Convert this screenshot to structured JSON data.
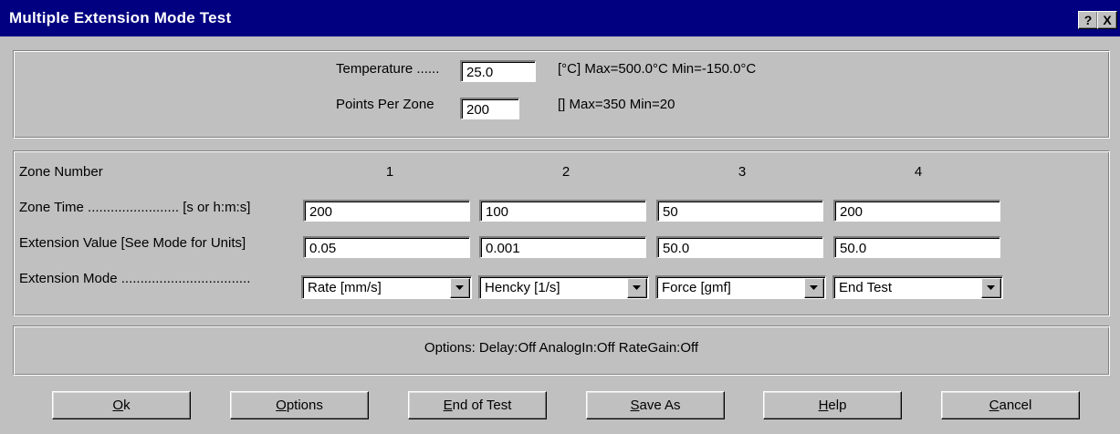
{
  "window": {
    "title": "Multiple Extension Mode Test",
    "help_glyph": "?",
    "close_glyph": "X"
  },
  "settings": {
    "temperature_label": "Temperature ......",
    "temperature_value": "25.0",
    "temperature_hint": "[°C] Max=500.0°C  Min=-150.0°C",
    "points_label": "Points Per Zone",
    "points_value": "200",
    "points_hint": "[] Max=350 Min=20"
  },
  "zones": {
    "header_label": "Zone Number",
    "numbers": [
      "1",
      "2",
      "3",
      "4"
    ],
    "time_label": "Zone Time ........................  [s or h:m:s]",
    "time_values": [
      "200",
      "100",
      "50",
      "200"
    ],
    "value_label": "Extension Value  [See Mode for Units]",
    "extension_values": [
      "0.05",
      "0.001",
      "50.0",
      "50.0"
    ],
    "mode_label": "Extension Mode ..................................",
    "modes": [
      "Rate [mm/s]",
      "Hencky [1/s]",
      "Force [gmf]",
      "End Test"
    ]
  },
  "options": {
    "summary": "Options:  Delay:Off  AnalogIn:Off  RateGain:Off"
  },
  "buttons": {
    "ok": {
      "accel": "O",
      "rest": "k"
    },
    "options": {
      "accel": "O",
      "rest": "ptions"
    },
    "end": {
      "accel": "E",
      "rest": "nd of Test"
    },
    "save": {
      "accel": "S",
      "rest": "ave As"
    },
    "help": {
      "accel": "H",
      "rest": "elp"
    },
    "cancel": {
      "accel": "C",
      "rest": "ancel"
    }
  }
}
